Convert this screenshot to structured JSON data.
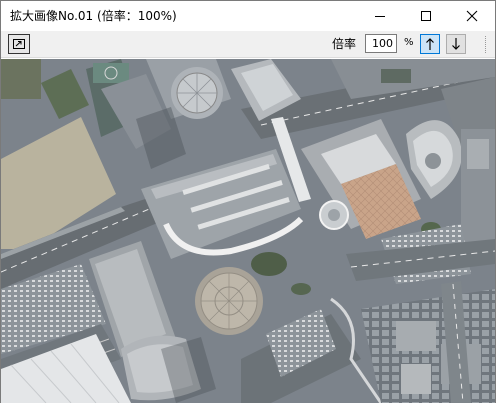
{
  "window": {
    "title": "拡大画像No.01 (倍率：100%)"
  },
  "caption_buttons": {
    "minimize": "minimize-icon",
    "maximize": "maximize-icon",
    "close": "close-icon"
  },
  "toolbar": {
    "fit_button_icon": "fit-window-icon",
    "rate_label": "倍率",
    "rate_value": "100",
    "percent_label": "%",
    "up_icon": "arrow-up-icon",
    "down_icon": "arrow-down-icon"
  },
  "image": {
    "description_icon": "aerial-photo"
  }
}
